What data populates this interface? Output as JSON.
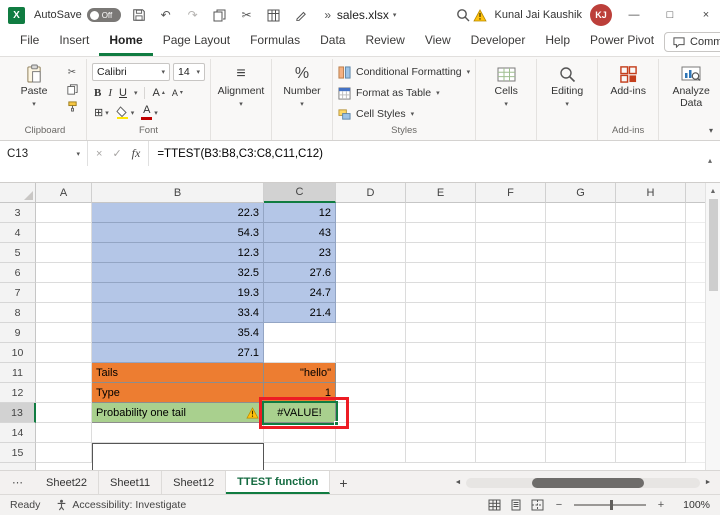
{
  "glyphs": {
    "dropdown": "▾",
    "collapse_up": "▴",
    "undo": "↶",
    "redo": "↷",
    "cut": "✂",
    "overflow": "»",
    "cancel": "×",
    "enter": "✓",
    "border": "⊞",
    "align": "≡",
    "ellipsis": "⋯",
    "add": "+",
    "minus": "−",
    "plus": "+",
    "scroll_left": "◄",
    "scroll_right": "►",
    "scroll_up": "▲",
    "minimize": "—",
    "maximize": "□",
    "close": "×",
    "logo": "X"
  },
  "title_bar": {
    "autosave_label": "AutoSave",
    "autosave_state": "Off",
    "filename": "sales.xlsx",
    "user_name": "Kunal Jai Kaushik",
    "user_initials": "KJ"
  },
  "tabs": {
    "items": [
      "File",
      "Insert",
      "Home",
      "Page Layout",
      "Formulas",
      "Data",
      "Review",
      "View",
      "Developer",
      "Help",
      "Power Pivot"
    ],
    "active": "Home",
    "comments_label": "Comments"
  },
  "ribbon": {
    "paste_label": "Paste",
    "clipboard_group": "Clipboard",
    "font_name": "Calibri",
    "font_size": "14",
    "bold": "B",
    "italic": "I",
    "underline": "U",
    "font_letter": "A",
    "font_group": "Font",
    "alignment_label": "Alignment",
    "number_label": "Number",
    "percent": "%",
    "conditional_formatting_label": "Conditional Formatting",
    "format_as_table_label": "Format as Table",
    "cell_styles_label": "Cell Styles",
    "styles_group": "Styles",
    "cells_label": "Cells",
    "editing_label": "Editing",
    "addins_label": "Add-ins",
    "addins_group": "Add-ins",
    "analyze_data_label": "Analyze Data"
  },
  "formula_bar": {
    "name_box": "C13",
    "fx": "fx",
    "formula": "=TTEST(B3:B8,C3:C8,C11,C12)"
  },
  "grid": {
    "columns": [
      "A",
      "B",
      "C",
      "D",
      "E",
      "F",
      "G",
      "H"
    ],
    "selected_column": "C",
    "selected_row": "13",
    "rows": [
      {
        "n": "3",
        "b": "22.3",
        "c": "12",
        "b_bg": "blue",
        "c_bg": "blue",
        "b_align": "right",
        "c_align": "right"
      },
      {
        "n": "4",
        "b": "54.3",
        "c": "43",
        "b_bg": "blue",
        "c_bg": "blue",
        "b_align": "right",
        "c_align": "right"
      },
      {
        "n": "5",
        "b": "12.3",
        "c": "23",
        "b_bg": "blue",
        "c_bg": "blue",
        "b_align": "right",
        "c_align": "right"
      },
      {
        "n": "6",
        "b": "32.5",
        "c": "27.6",
        "b_bg": "blue",
        "c_bg": "blue",
        "b_align": "right",
        "c_align": "right"
      },
      {
        "n": "7",
        "b": "19.3",
        "c": "24.7",
        "b_bg": "blue",
        "c_bg": "blue",
        "b_align": "right",
        "c_align": "right"
      },
      {
        "n": "8",
        "b": "33.4",
        "c": "21.4",
        "b_bg": "blue",
        "c_bg": "blue",
        "b_align": "right",
        "c_align": "right"
      },
      {
        "n": "9",
        "b": "35.4",
        "c": "",
        "b_bg": "blue",
        "c_bg": "none",
        "b_align": "right",
        "c_align": "right"
      },
      {
        "n": "10",
        "b": "27.1",
        "c": "",
        "b_bg": "blue",
        "c_bg": "none",
        "b_align": "right",
        "c_align": "right"
      },
      {
        "n": "11",
        "b": "Tails",
        "c": "\"hello\"",
        "b_bg": "orange",
        "c_bg": "orange",
        "b_align": "left",
        "c_align": "right"
      },
      {
        "n": "12",
        "b": "Type",
        "c": "1",
        "b_bg": "orange",
        "c_bg": "orange",
        "b_align": "left",
        "c_align": "right"
      },
      {
        "n": "13",
        "b": "Probability one tail",
        "c": "#VALUE!",
        "b_bg": "green",
        "c_bg": "green",
        "b_align": "left",
        "c_align": "center",
        "warn": true,
        "sel": true
      },
      {
        "n": "14",
        "b": "",
        "c": "",
        "b_bg": "none",
        "c_bg": "none",
        "b_align": "left",
        "c_align": "left"
      },
      {
        "n": "15",
        "b": "",
        "c": "",
        "b_bg": "none",
        "c_bg": "none",
        "b_align": "left",
        "c_align": "left",
        "boxed": true
      }
    ]
  },
  "sheet_bar": {
    "tabs": [
      "Sheet22",
      "Sheet11",
      "Sheet12",
      "TTEST function"
    ],
    "active": "TTEST function"
  },
  "status_bar": {
    "ready": "Ready",
    "accessibility": "Accessibility: Investigate",
    "zoom": "100%"
  },
  "colors": {
    "accent_green": "#107C41",
    "cell_blue": "#b4c6e7",
    "cell_orange": "#ed7d31",
    "cell_green": "#a9d08e",
    "annotation_red": "#ed1c24"
  }
}
